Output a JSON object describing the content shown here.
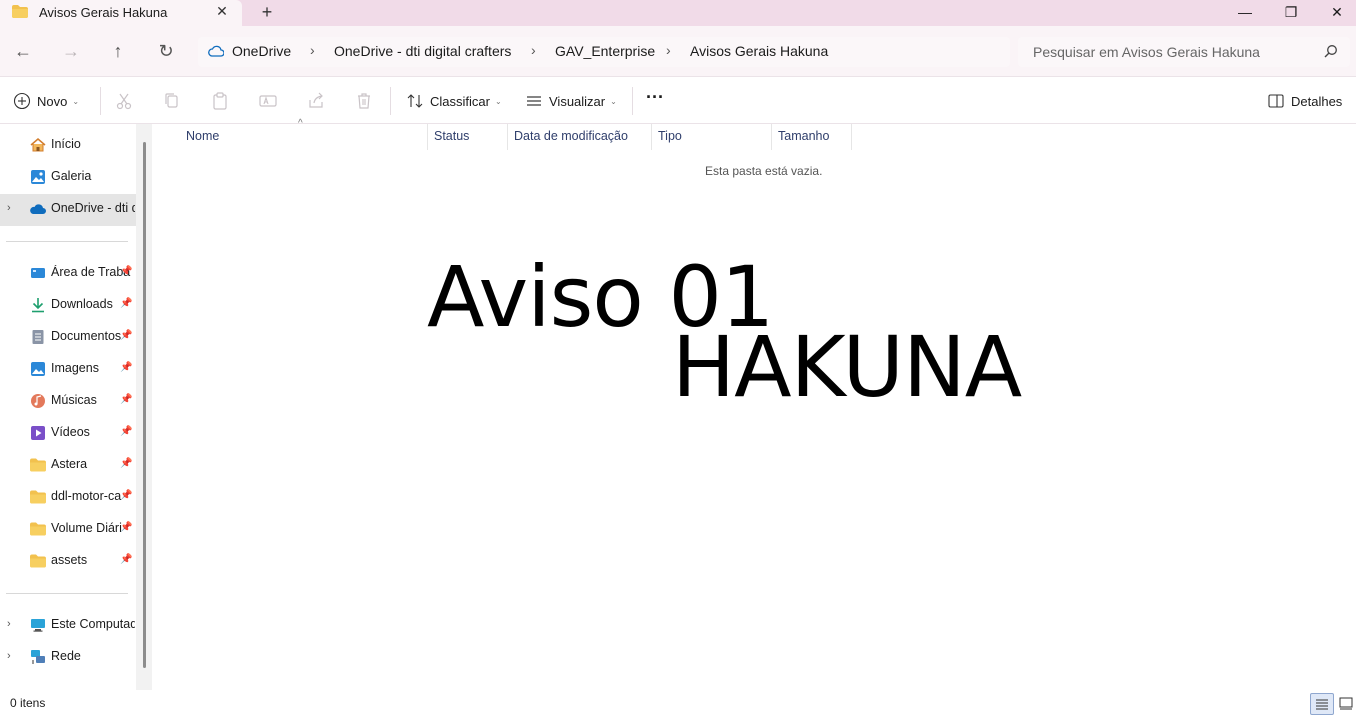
{
  "tab": {
    "title": "Avisos Gerais Hakuna",
    "close_glyph": "✕",
    "new_tab_glyph": "+"
  },
  "window_controls": {
    "minimize": "—",
    "maximize": "❐",
    "close": "✕"
  },
  "nav": {
    "back": "←",
    "forward": "→",
    "up": "↑",
    "refresh": "↻"
  },
  "breadcrumb": [
    {
      "label": "OneDrive"
    },
    {
      "label": "OneDrive - dti digital crafters"
    },
    {
      "label": "GAV_Enterprise"
    },
    {
      "label": "Avisos Gerais Hakuna"
    }
  ],
  "breadcrumb_sep": "›",
  "search": {
    "placeholder": "Pesquisar em Avisos Gerais Hakuna"
  },
  "toolbar": {
    "new_label": "Novo",
    "sort_label": "Classificar",
    "view_label": "Visualizar",
    "more_label": "···",
    "details_label": "Detalhes",
    "caret": "⌄"
  },
  "sidebar": {
    "top_items": [
      {
        "label": "Início",
        "icon": "home-icon"
      },
      {
        "label": "Galeria",
        "icon": "gallery-icon"
      },
      {
        "label": "OneDrive - dti d",
        "icon": "onedrive-icon",
        "selected": true
      }
    ],
    "pinned_items": [
      {
        "label": "Área de Traba",
        "icon": "desktop-icon"
      },
      {
        "label": "Downloads",
        "icon": "download-icon"
      },
      {
        "label": "Documentos",
        "icon": "documents-icon"
      },
      {
        "label": "Imagens",
        "icon": "pictures-icon"
      },
      {
        "label": "Músicas",
        "icon": "music-icon"
      },
      {
        "label": "Vídeos",
        "icon": "videos-icon"
      },
      {
        "label": "Astera",
        "icon": "folder-icon"
      },
      {
        "label": "ddl-motor-ca",
        "icon": "folder-icon"
      },
      {
        "label": "Volume Diári",
        "icon": "folder-icon"
      },
      {
        "label": "assets",
        "icon": "folder-icon"
      }
    ],
    "bottom_items": [
      {
        "label": "Este Computado",
        "icon": "computer-icon"
      },
      {
        "label": "Rede",
        "icon": "network-icon"
      }
    ],
    "pin_glyph": "📌",
    "chevron": "›"
  },
  "columns": {
    "name": "Nome",
    "status": "Status",
    "modified": "Data de modificação",
    "type": "Tipo",
    "size": "Tamanho",
    "sort_glyph": "^"
  },
  "content": {
    "empty_message": "Esta pasta está vazia.",
    "overlay_line1": "Aviso 01",
    "overlay_line2": "HAKUNA"
  },
  "status_bar": {
    "items_count": "0 itens"
  },
  "colors": {
    "tabbar_bg": "#f1dbe8",
    "nav_bg": "#faf4f7",
    "accent": "#0067c0",
    "folder": "#f2c14e"
  }
}
